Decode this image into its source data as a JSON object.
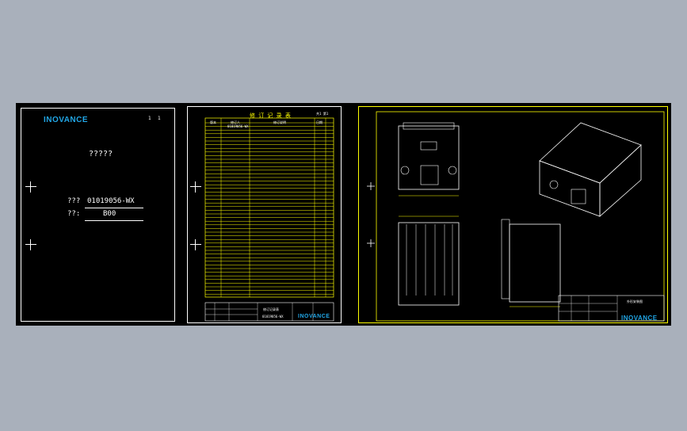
{
  "cover_sheet": {
    "logo": "INOVANCE",
    "corner_a": "1",
    "corner_b": "1",
    "title": "?????",
    "number_label": "???",
    "number_value": "01019056-WX",
    "version_label": "??:",
    "version_value": "B00"
  },
  "revision_sheet": {
    "title": "修 订 记 录 表",
    "page_label": "共1  第1",
    "header_1": "版本",
    "header_2": "修订人",
    "header_3": "修订说明",
    "header_4": "日期",
    "first_row_code": "01019056-WX",
    "title_block_name": "修订记录表",
    "title_block_number": "01019056-WX",
    "logo": "INOVANCE"
  },
  "drawing_sheet": {
    "title_block_name": "外形安装图",
    "logo": "INOVANCE"
  },
  "colors": {
    "background": "#a9b0bb",
    "canvas": "#000000",
    "frame": "#ffffff",
    "drawing": "#ffff00",
    "logo": "#21a6e6"
  }
}
